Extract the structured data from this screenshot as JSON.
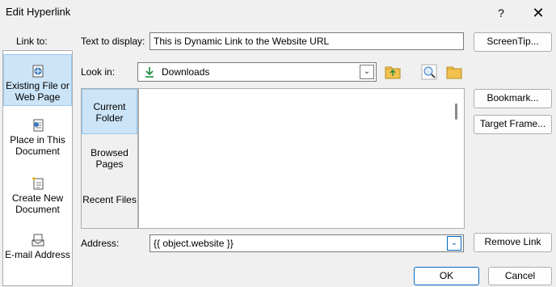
{
  "dialog": {
    "title": "Edit Hyperlink",
    "help_glyph": "?",
    "close_glyph": "✕"
  },
  "link_to": {
    "label": "Link to:",
    "items": [
      {
        "label": "Existing File or Web Page",
        "icon": "web-page-icon",
        "selected": true
      },
      {
        "label": "Place in This Document",
        "icon": "document-place-icon",
        "selected": false
      },
      {
        "label": "Create New Document",
        "icon": "new-document-icon",
        "selected": false
      },
      {
        "label": "E-mail Address",
        "icon": "email-icon",
        "selected": false
      }
    ]
  },
  "text_to_display": {
    "label": "Text to display:",
    "value": "This is Dynamic Link to the Website URL"
  },
  "screentip_button": "ScreenTip...",
  "look_in": {
    "label": "Look in:",
    "value": "Downloads",
    "icon": "download-arrow-icon"
  },
  "toolbar_icons": [
    "up-folder-icon",
    "browse-web-icon",
    "browse-folder-icon"
  ],
  "side_tabs": [
    {
      "label": "Current Folder",
      "selected": true
    },
    {
      "label": "Browsed Pages",
      "selected": false
    },
    {
      "label": "Recent Files",
      "selected": false
    }
  ],
  "bookmark_button": "Bookmark...",
  "target_frame_button": "Target Frame...",
  "address": {
    "label": "Address:",
    "value": "{{ object.website }}"
  },
  "remove_link_button": "Remove Link",
  "ok_button": "OK",
  "cancel_button": "Cancel",
  "colors": {
    "selection_bg": "#cce4f7",
    "accent": "#0067c0",
    "download_green": "#1a8a3c",
    "folder_yellow": "#f2c14e"
  }
}
